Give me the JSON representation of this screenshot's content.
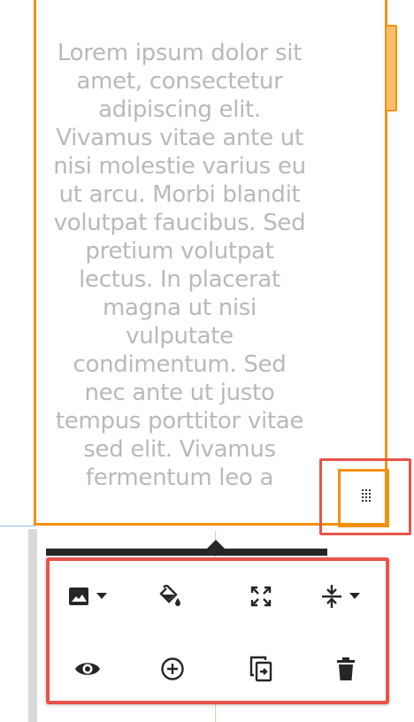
{
  "text_block": {
    "content": "Lorem ipsum dolor sit\namet, consectetur\nadipiscing elit.\nVivamus vitae ante ut\nnisi molestie varius eu\nut arcu. Morbi blandit\nvolutpat faucibus. Sed\npretium volutpat\nlectus. In placerat\nmagna ut nisi\nvulputate\ncondimentum. Sed\nnec ante ut justo\ntempus porttitor vitae\nsed elit. Vivamus\nfermentum leo a"
  },
  "colors": {
    "selection_border": "#f29111",
    "highlight_border": "#e8534a",
    "text": "#b9b9b9",
    "icon": "#262626"
  },
  "toolbar": {
    "row1": [
      {
        "icon": "image-icon",
        "has_dropdown": true
      },
      {
        "icon": "fill-color-icon",
        "has_dropdown": false
      },
      {
        "icon": "fullscreen-icon",
        "has_dropdown": false
      },
      {
        "icon": "vertical-align-center-icon",
        "has_dropdown": true
      }
    ],
    "row2": [
      {
        "icon": "eye-icon"
      },
      {
        "icon": "add-circle-icon"
      },
      {
        "icon": "duplicate-icon"
      },
      {
        "icon": "trash-icon"
      }
    ]
  }
}
